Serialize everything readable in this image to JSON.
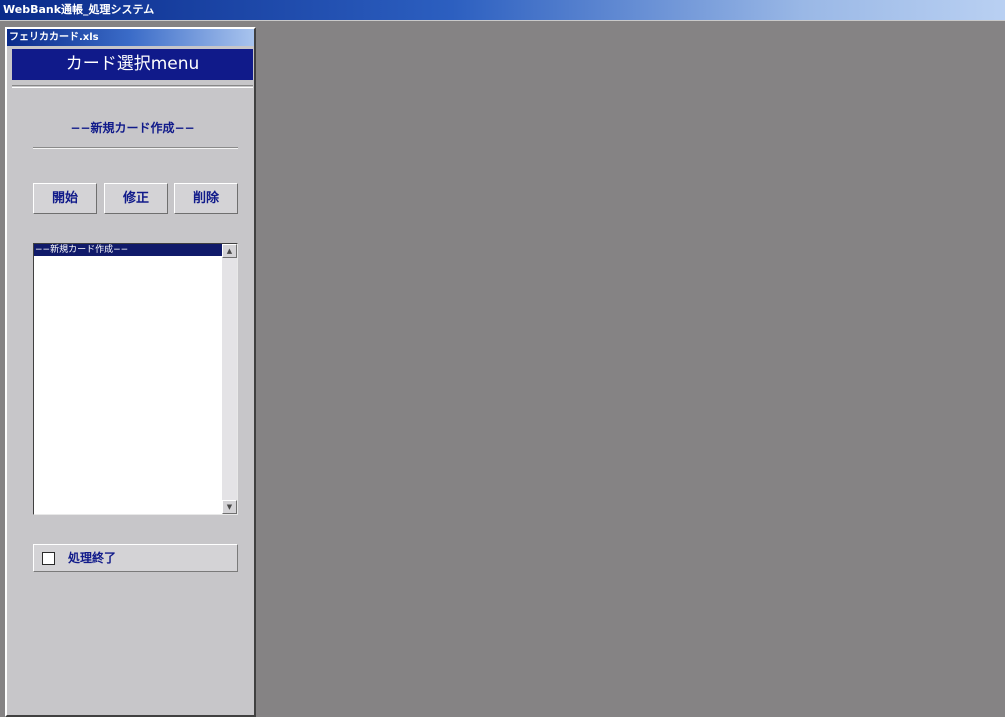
{
  "app": {
    "title": "WebBank通帳_処理システム"
  },
  "panel": {
    "title": "フェリカカード.xls",
    "menu_title": "カード選択menu",
    "mode_label": "−−新規カード作成−−",
    "buttons": {
      "start": "開始",
      "edit": "修正",
      "delete": "削除"
    },
    "list": {
      "items": [
        "−−新規カード作成−−"
      ],
      "selected_index": 0
    },
    "checkbox": {
      "label": "処理終了",
      "checked": false
    }
  },
  "colors": {
    "accent_navy": "#101a8a",
    "workspace_gray": "#858384",
    "panel_gray": "#c7c6c9"
  },
  "icons": {
    "scroll_up": "triangle-up-icon",
    "scroll_down": "triangle-down-icon"
  }
}
